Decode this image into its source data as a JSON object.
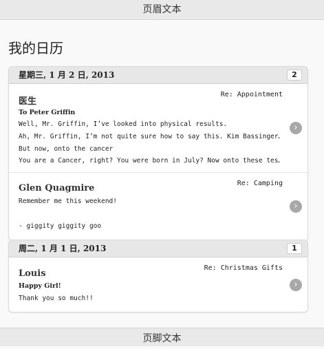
{
  "header": {
    "title": "页眉文本"
  },
  "page": {
    "title": "我的日历"
  },
  "footer": {
    "title": "页脚文本"
  },
  "groups": [
    {
      "date": "星期三, 1 月 2 日, 2013",
      "count": "2",
      "messages": [
        {
          "name": "医生",
          "subject": "Re: Appointment",
          "lines": [
            "To Peter Griffin",
            "Well, Mr. Griffin, I’ve looked into physical results.",
            "Ah, Mr. Griffin, I’m not quite sure how to say this. Kim Bassinger…",
            "But now, onto the cancer",
            "You are a Cancer, right? You were born in July? Now onto these tes…"
          ]
        },
        {
          "name": "Glen Quagmire",
          "subject": "Re: Camping",
          "lines": [
            "Remember me this weekend!",
            "- giggity giggity goo"
          ]
        }
      ]
    },
    {
      "date": "周二, 1 月 1 日, 2013",
      "count": "1",
      "messages": [
        {
          "name": "Louis",
          "subject": "Re: Christmas Gifts",
          "lines": [
            "Happy Girl!",
            "Thank you so much!!"
          ]
        }
      ]
    }
  ]
}
